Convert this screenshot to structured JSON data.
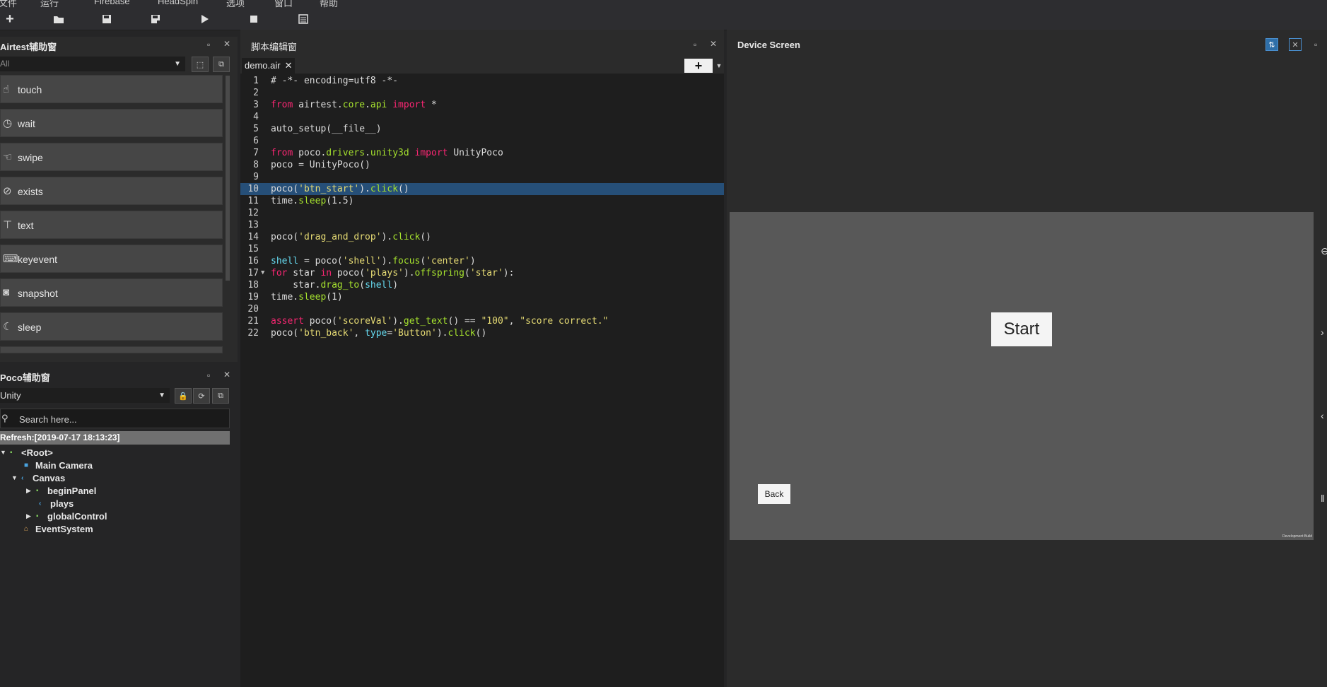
{
  "menubar": {
    "items": [
      "文件",
      "运行",
      "Firebase",
      "HeadSpin",
      "选项",
      "窗口",
      "帮助"
    ]
  },
  "toolbar": {
    "new_icon": "plus-icon",
    "open_icon": "folder-icon",
    "save_icon": "save-icon",
    "save_as_icon": "save-as-icon",
    "run_icon": "play-icon",
    "stop_icon": "stop-icon",
    "log_icon": "list-icon"
  },
  "airtest": {
    "title": "Airtest辅助窗",
    "filter_value": "All",
    "commands": [
      {
        "label": "touch",
        "icon": "hand-icon"
      },
      {
        "label": "wait",
        "icon": "clock-icon"
      },
      {
        "label": "swipe",
        "icon": "swipe-icon"
      },
      {
        "label": "exists",
        "icon": "check-circle-icon"
      },
      {
        "label": "text",
        "icon": "text-icon"
      },
      {
        "label": "keyevent",
        "icon": "keyboard-icon"
      },
      {
        "label": "snapshot",
        "icon": "camera-icon"
      },
      {
        "label": "sleep",
        "icon": "moon-icon"
      }
    ]
  },
  "poco": {
    "title": "Poco辅助窗",
    "mode": "Unity",
    "search_placeholder": "Search here...",
    "refresh_text": "Refresh:[2019-07-17 18:13:23]",
    "tree": [
      {
        "label": "<Root>",
        "color": "#7cc35a"
      },
      {
        "label": "Main Camera",
        "color": "#4aa3df"
      },
      {
        "label": "Canvas",
        "color": "#4aa3df"
      },
      {
        "label": "beginPanel",
        "color": "#7cc35a"
      },
      {
        "label": "plays",
        "color": "#4aa3df"
      },
      {
        "label": "globalControl",
        "color": "#7cc35a"
      },
      {
        "label": "EventSystem",
        "color": "#d9a35a"
      }
    ]
  },
  "editor": {
    "title": "脚本编辑窗",
    "tab_label": "demo.air",
    "add_label": "+",
    "lines": [
      "1",
      "2",
      "3",
      "4",
      "5",
      "6",
      "7",
      "8",
      "9",
      "10",
      "11",
      "12",
      "13",
      "14",
      "15",
      "16",
      "17",
      "18",
      "19",
      "20",
      "21",
      "22"
    ],
    "code": {
      "l1": "# -*- encoding=utf8 -*-",
      "l3a": "from",
      "l3b": " airtest.",
      "l3c": "core",
      "l3d": ".",
      "l3e": "api",
      "l3f": " import",
      "l3g": " *",
      "l5": "auto_setup(__file__)",
      "l7a": "from",
      "l7b": " poco.",
      "l7c": "drivers",
      "l7d": ".",
      "l7e": "unity3d",
      "l7f": " import",
      "l7g": " UnityPoco",
      "l8": "poco = UnityPoco()",
      "l10a": "poco(",
      "l10b": "'btn_start'",
      "l10c": ").",
      "l10d": "click",
      "l10e": "()",
      "l11a": "time.",
      "l11b": "sleep",
      "l11c": "(1.5)",
      "l14a": "poco(",
      "l14b": "'drag_and_drop'",
      "l14c": ").",
      "l14d": "click",
      "l14e": "()",
      "l16a": "shell",
      "l16b": " = poco(",
      "l16c": "'shell'",
      "l16d": ").",
      "l16e": "focus",
      "l16f": "(",
      "l16g": "'center'",
      "l16h": ")",
      "l17a": "for",
      "l17b": " star ",
      "l17c": "in",
      "l17d": " poco(",
      "l17e": "'plays'",
      "l17f": ").",
      "l17g": "offspring",
      "l17h": "(",
      "l17i": "'star'",
      "l17j": "):",
      "l18a": "    star.",
      "l18b": "drag_to",
      "l18c": "(",
      "l18d": "shell",
      "l18e": ")",
      "l19a": "time.",
      "l19b": "sleep",
      "l19c": "(1)",
      "l21a": "assert",
      "l21b": " poco(",
      "l21c": "'scoreVal'",
      "l21d": ").",
      "l21e": "get_text",
      "l21f": "() == ",
      "l21g": "\"100\"",
      "l21h": ", ",
      "l21i": "\"score correct.\"",
      "l22a": "poco(",
      "l22b": "'btn_back'",
      "l22c": ", ",
      "l22d": "type",
      "l22e": "=",
      "l22f": "'Button'",
      "l22g": ").",
      "l22h": "click",
      "l22i": "()"
    }
  },
  "device": {
    "title": "Device Screen",
    "start_label": "Start",
    "back_label": "Back",
    "build_label": "Development Build"
  }
}
